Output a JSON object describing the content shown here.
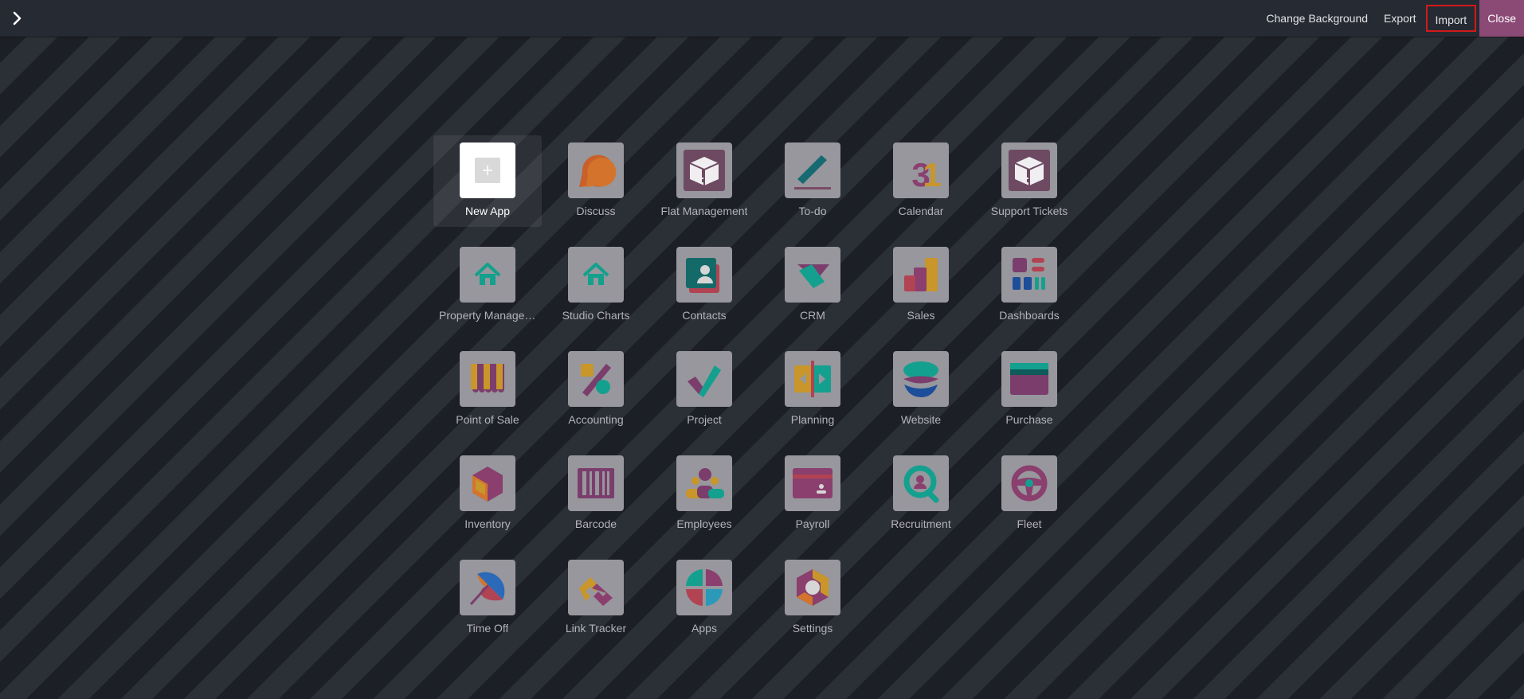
{
  "topbar": {
    "toggle_icon": "chevron-right-icon",
    "change_background": "Change Background",
    "export": "Export",
    "import": "Import",
    "close": "Close"
  },
  "apps": [
    {
      "label": "New App",
      "icon": "plus-icon"
    },
    {
      "label": "Discuss",
      "icon": "chat-bubble-icon"
    },
    {
      "label": "Flat Management",
      "icon": "box-icon"
    },
    {
      "label": "To-do",
      "icon": "pen-icon"
    },
    {
      "label": "Calendar",
      "icon": "calendar-31-icon"
    },
    {
      "label": "Support Tickets",
      "icon": "box-icon"
    },
    {
      "label": "Property Management",
      "icon": "house-icon"
    },
    {
      "label": "Studio Charts",
      "icon": "house-icon"
    },
    {
      "label": "Contacts",
      "icon": "contact-card-icon"
    },
    {
      "label": "CRM",
      "icon": "handshake-icon"
    },
    {
      "label": "Sales",
      "icon": "bar-chart-icon"
    },
    {
      "label": "Dashboards",
      "icon": "dashboard-icon"
    },
    {
      "label": "Point of Sale",
      "icon": "shop-awning-icon"
    },
    {
      "label": "Accounting",
      "icon": "percent-icon"
    },
    {
      "label": "Project",
      "icon": "checkmark-icon"
    },
    {
      "label": "Planning",
      "icon": "planning-arrows-icon"
    },
    {
      "label": "Website",
      "icon": "globe-waves-icon"
    },
    {
      "label": "Purchase",
      "icon": "credit-card-icon"
    },
    {
      "label": "Inventory",
      "icon": "cube-icon"
    },
    {
      "label": "Barcode",
      "icon": "barcode-icon"
    },
    {
      "label": "Employees",
      "icon": "people-icon"
    },
    {
      "label": "Payroll",
      "icon": "payslip-card-icon"
    },
    {
      "label": "Recruitment",
      "icon": "search-person-icon"
    },
    {
      "label": "Fleet",
      "icon": "steering-wheel-icon"
    },
    {
      "label": "Time Off",
      "icon": "umbrella-icon"
    },
    {
      "label": "Link Tracker",
      "icon": "chain-link-icon"
    },
    {
      "label": "Apps",
      "icon": "quadrant-ball-icon"
    },
    {
      "label": "Settings",
      "icon": "hexagon-gear-icon"
    }
  ]
}
